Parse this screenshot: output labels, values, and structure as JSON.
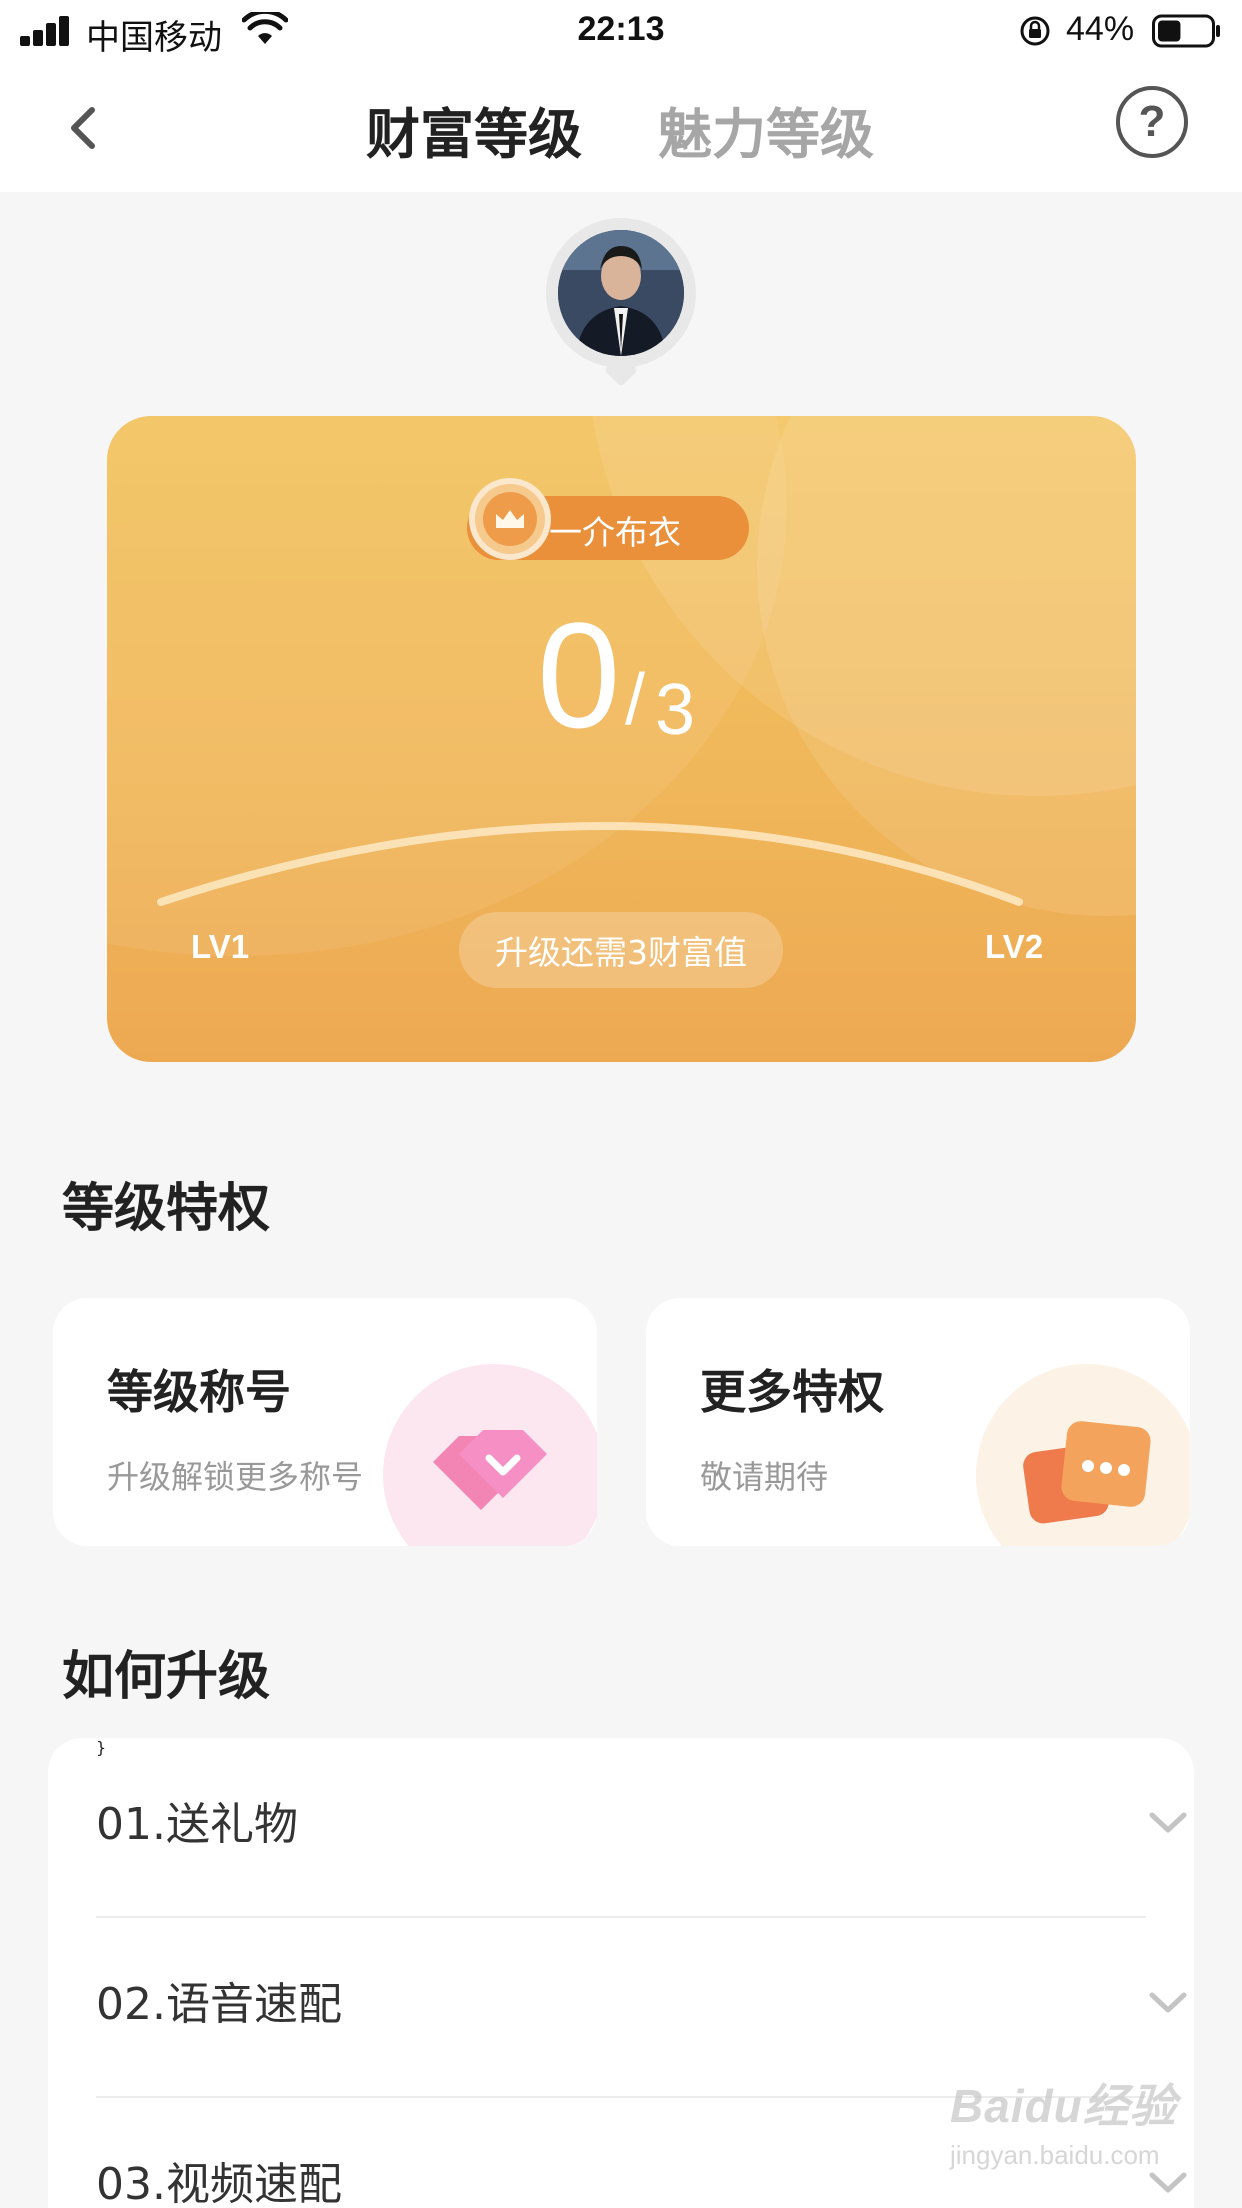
{
  "status_bar": {
    "carrier": "中国移动",
    "time": "22:13",
    "battery_percent": "44%",
    "battery_level": 0.44
  },
  "nav": {
    "tabs": [
      {
        "label": "财富等级",
        "active": true
      },
      {
        "label": "魅力等级",
        "active": false
      }
    ],
    "back_icon": "chevron-left-icon",
    "help_icon": "question-circle-icon",
    "help_glyph": "?"
  },
  "level_card": {
    "title_badge": "一介布衣",
    "score_current": "0",
    "score_separator": "/",
    "score_max": "3",
    "progress_fraction": 0,
    "level_start": "LV1",
    "level_end": "LV2",
    "upgrade_hint": "升级还需3财富值",
    "colors": {
      "card_top": "#f3c35e",
      "card_bottom": "#eda952",
      "badge": "#ea8f3a"
    }
  },
  "privileges": {
    "section_title": "等级特权",
    "cards": [
      {
        "title": "等级称号",
        "subtitle": "升级解锁更多称号",
        "icon": "heart-badge-icon"
      },
      {
        "title": "更多特权",
        "subtitle": "敬请期待",
        "icon": "chat-cards-icon"
      }
    ]
  },
  "howto": {
    "section_title": "如何升级",
    "items": [
      {
        "label": "01.送礼物"
      },
      {
        "label": "02.语音速配"
      },
      {
        "label": "03.视频速配"
      }
    ]
  },
  "watermark": {
    "brand": "Baidu经验",
    "url": "jingyan.baidu.com"
  }
}
